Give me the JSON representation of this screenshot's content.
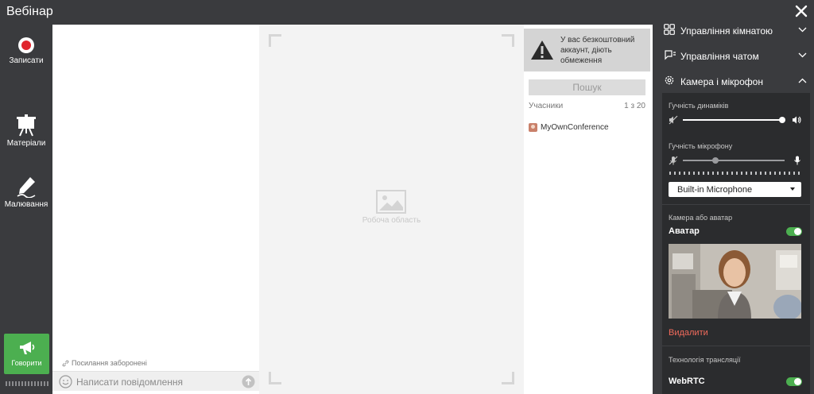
{
  "window": {
    "title": "Вебінар"
  },
  "toolbar": {
    "record_label": "Записати",
    "materials_label": "Матеріали",
    "draw_label": "Малювання",
    "speak_label": "Говорити"
  },
  "chat": {
    "links_forbidden": "Посилання заборонені",
    "input_placeholder": "Написати повідомлення"
  },
  "workspace": {
    "label": "Робоча область"
  },
  "participants": {
    "warning_lines": [
      "У вас безкоштовний",
      "аккаунт, діють",
      "обмеження"
    ],
    "search_label": "Пошук",
    "header": "Учасники",
    "count": "1 з 20",
    "items": [
      {
        "name": "MyOwnConference"
      }
    ]
  },
  "settings": {
    "room_management": "Управління кімнатою",
    "chat_management": "Управління чатом",
    "camera_mic": "Камера і мікрофон",
    "speaker_volume_label": "Гучність динаміків",
    "speaker_volume": 0.98,
    "mic_volume_label": "Гучність мікрофону",
    "mic_volume": 0.32,
    "mic_device": "Built-in Microphone",
    "camera_section_label": "Камера або аватар",
    "avatar_label": "Аватар",
    "avatar_enabled": true,
    "delete_label": "Видалити",
    "broadcast_label": "Технологія трансляції",
    "webrtc_label": "WebRTC",
    "webrtc_enabled": true
  },
  "colors": {
    "accent_green": "#4caf50",
    "danger": "#f26b5c",
    "background": "#3a3b3e"
  }
}
